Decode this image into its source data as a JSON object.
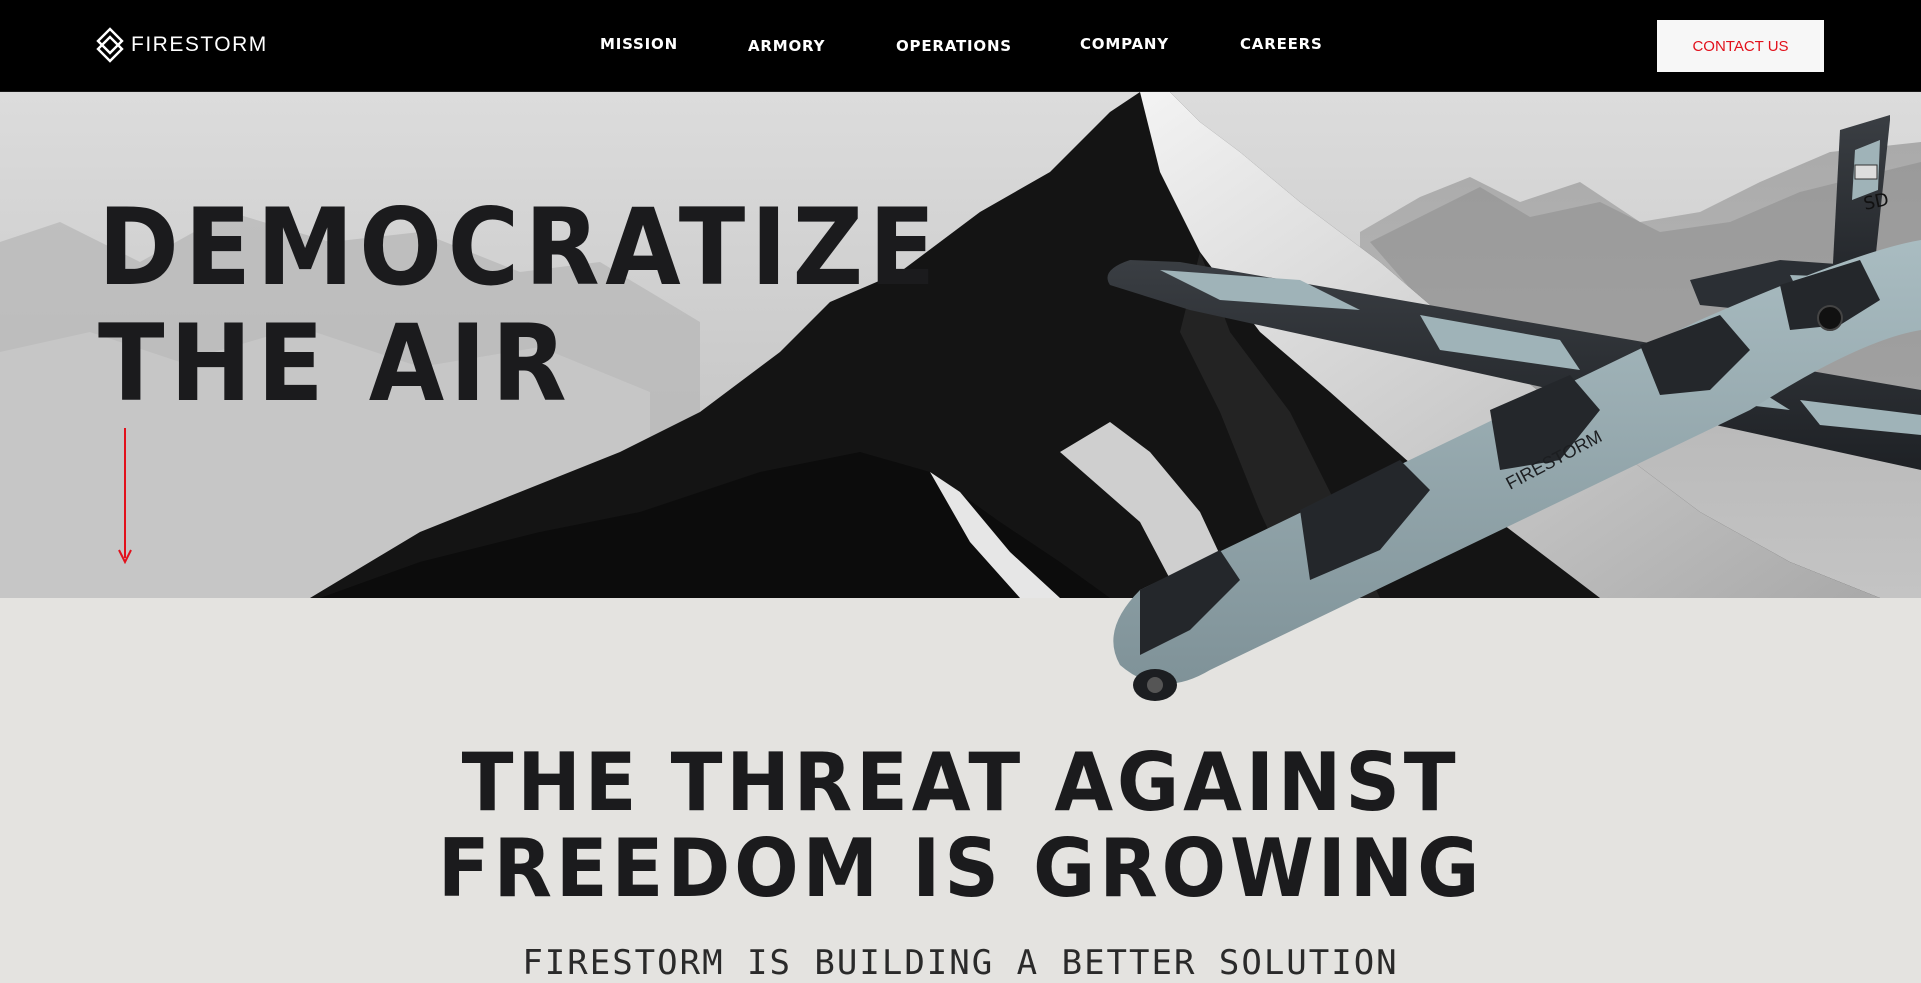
{
  "brand": {
    "name": "FIRESTORM",
    "logo_icon": "firestorm-diamond-logo"
  },
  "nav": {
    "items": [
      {
        "label": "MISSION"
      },
      {
        "label": "ARMORY"
      },
      {
        "label": "OPERATIONS"
      },
      {
        "label": "COMPANY"
      },
      {
        "label": "CAREERS"
      }
    ],
    "contact_label": "CONTACT US"
  },
  "hero": {
    "title_line1": "DEMOCRATIZE",
    "title_line2": "THE AIR",
    "scroll_icon": "arrow-down-icon",
    "drone_tail_text": "SD",
    "drone_fuselage_text": "FIRESTORM"
  },
  "threat": {
    "title_line1": "THE THREAT AGAINST",
    "title_line2": "FREEDOM IS GROWING",
    "subtitle": "FIRESTORM IS BUILDING A BETTER SOLUTION"
  },
  "colors": {
    "accent": "#e2101b",
    "nav_bg": "#000000",
    "page_bg": "#e4e3e0",
    "drone_camo": "#9fb3b8",
    "drone_dark": "#24272b"
  }
}
